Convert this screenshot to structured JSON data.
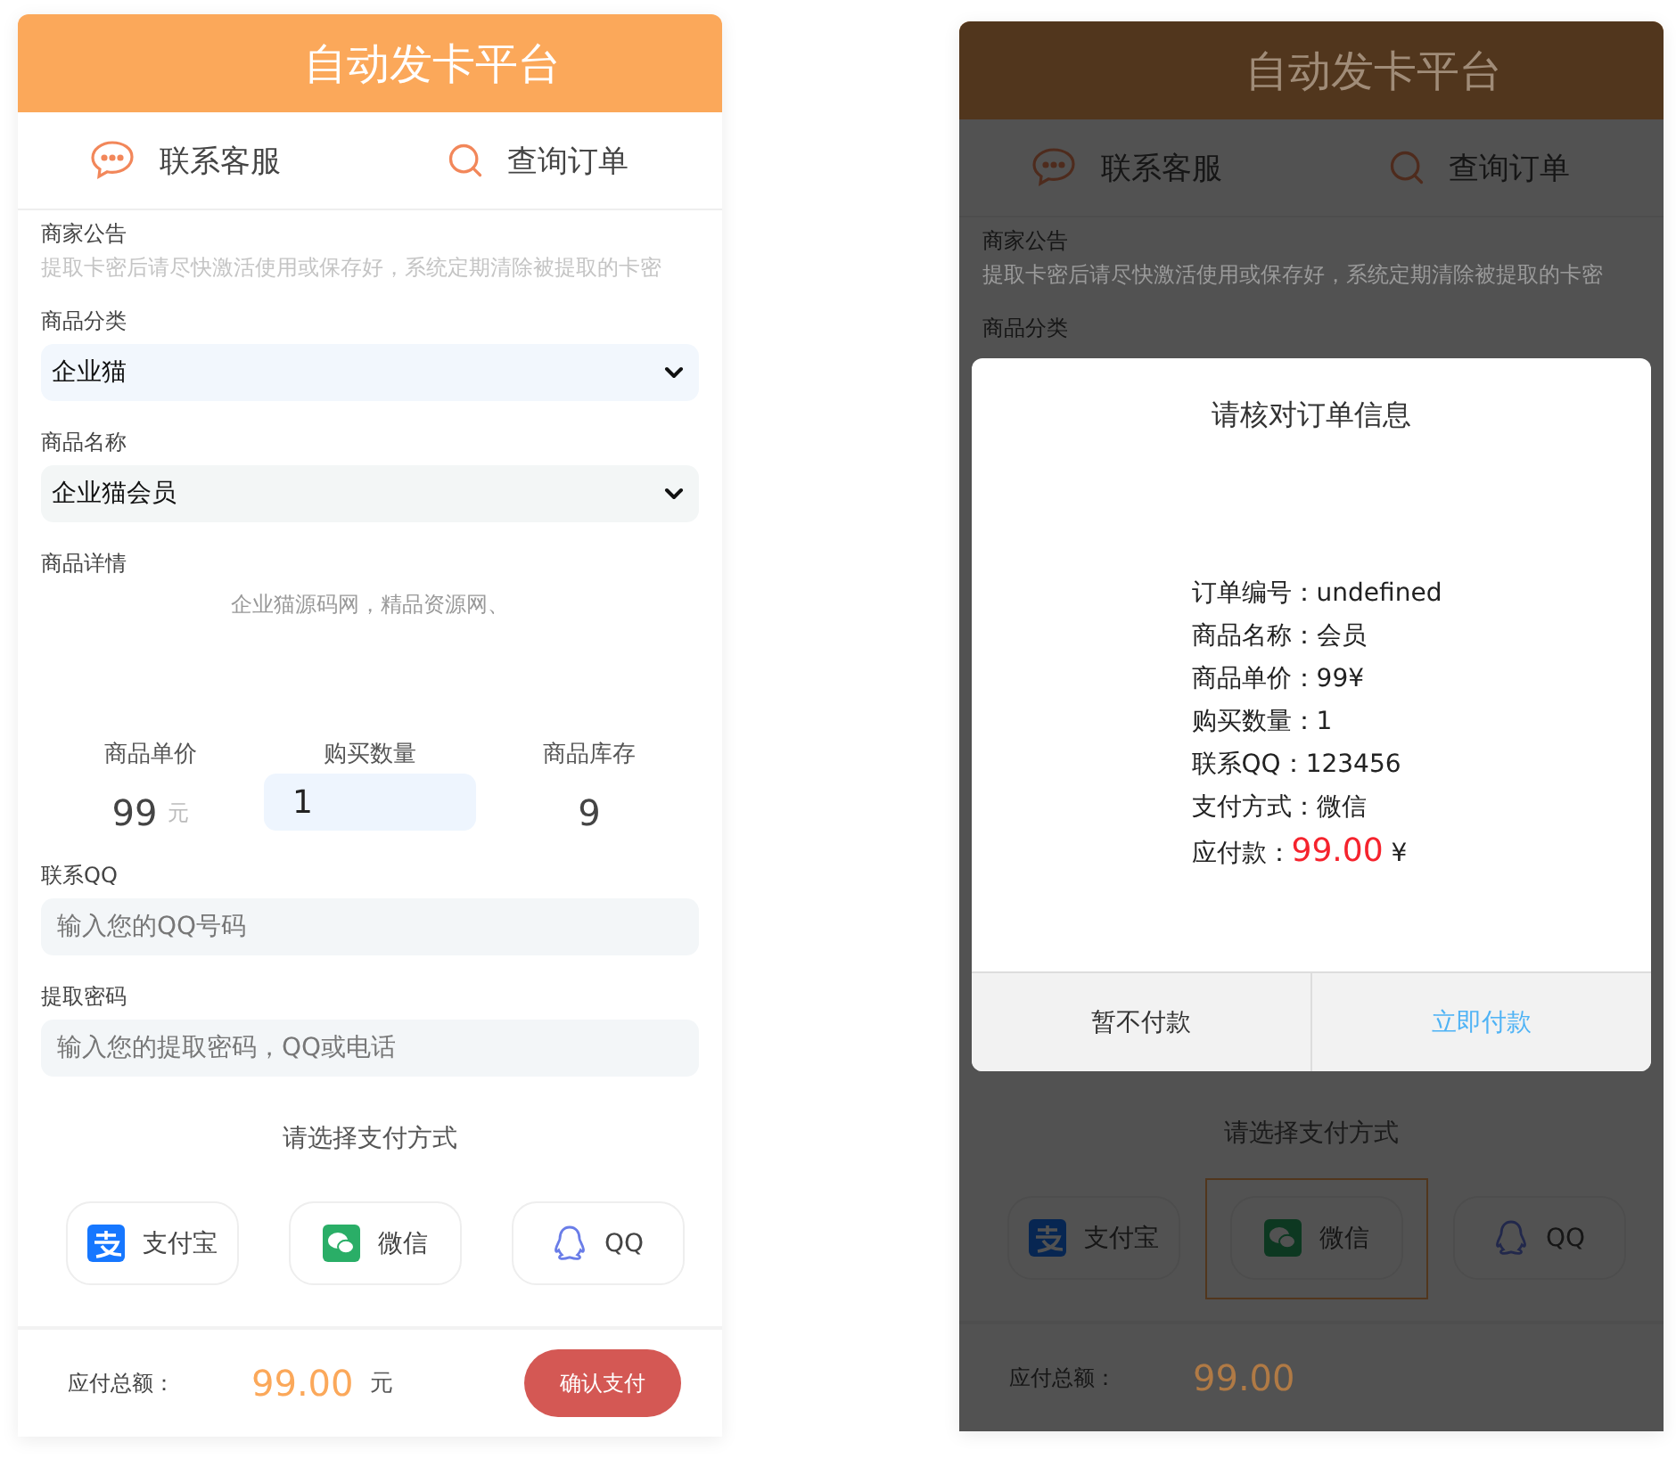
{
  "screens": [
    {
      "header": {
        "title": "自动发卡平台"
      },
      "nav": [
        {
          "kind": "chat",
          "label": "联系客服"
        },
        {
          "kind": "search",
          "label": "查询订单"
        }
      ],
      "notice": {
        "label": "商家公告",
        "text": "提取卡密后请尽快激活使用或保存好，系统定期清除被提取的卡密"
      },
      "category": {
        "label": "商品分类",
        "value": "企业猫"
      },
      "product": {
        "label": "商品名称",
        "value": "企业猫会员"
      },
      "details": {
        "label": "商品详情",
        "text": "企业猫源码网，精品资源网、"
      },
      "stats": {
        "price_label": "商品单价",
        "price": "99",
        "price_unit": "元",
        "quantity_label": "购买数量",
        "quantity": "1",
        "stock_label": "商品库存",
        "stock": "9"
      },
      "qq": {
        "label": "联系QQ",
        "placeholder": "输入您的QQ号码"
      },
      "password": {
        "label": "提取密码",
        "placeholder": "输入您的提取密码，QQ或电话"
      },
      "payment": {
        "title": "请选择支付方式",
        "methods": [
          {
            "kind": "alipay",
            "label": "支付宝",
            "selected": false
          },
          {
            "kind": "wechat",
            "label": "微信",
            "selected": false
          },
          {
            "kind": "qq",
            "label": "QQ",
            "selected": false
          }
        ]
      },
      "footer": {
        "label": "应付总额：",
        "amount": "99.00",
        "unit": "元",
        "button": "确认支付"
      }
    },
    {
      "header": {
        "title": "自动发卡平台"
      },
      "nav": [
        {
          "kind": "chat",
          "label": "联系客服"
        },
        {
          "kind": "search",
          "label": "查询订单"
        }
      ],
      "notice": {
        "label": "商家公告",
        "text": "提取卡密后请尽快激活使用或保存好，系统定期清除被提取的卡密"
      },
      "category": {
        "label": "商品分类"
      },
      "dialog": {
        "title": "请核对订单信息",
        "lines": [
          {
            "kind": "plain",
            "label": "订单编号：",
            "value": "undefined"
          },
          {
            "kind": "plain",
            "label": "商品名称：",
            "value": "会员"
          },
          {
            "kind": "plain",
            "label": "商品单价：",
            "value": "99¥"
          },
          {
            "kind": "plain",
            "label": "购买数量：",
            "value": "1"
          },
          {
            "kind": "plain",
            "label": "联系QQ：",
            "value": "123456"
          },
          {
            "kind": "plain",
            "label": "支付方式：",
            "value": "微信"
          },
          {
            "kind": "amount",
            "label": "应付款：",
            "value": "99.00",
            "unit": "¥"
          }
        ],
        "cancel": "暂不付款",
        "confirm": "立即付款"
      },
      "payment": {
        "title": "请选择支付方式",
        "methods": [
          {
            "kind": "alipay",
            "label": "支付宝",
            "selected": false
          },
          {
            "kind": "wechat",
            "label": "微信",
            "selected": true
          },
          {
            "kind": "qq",
            "label": "QQ",
            "selected": false
          }
        ]
      },
      "footer": {
        "label": "应付总额：",
        "amount": "99.00"
      }
    }
  ]
}
